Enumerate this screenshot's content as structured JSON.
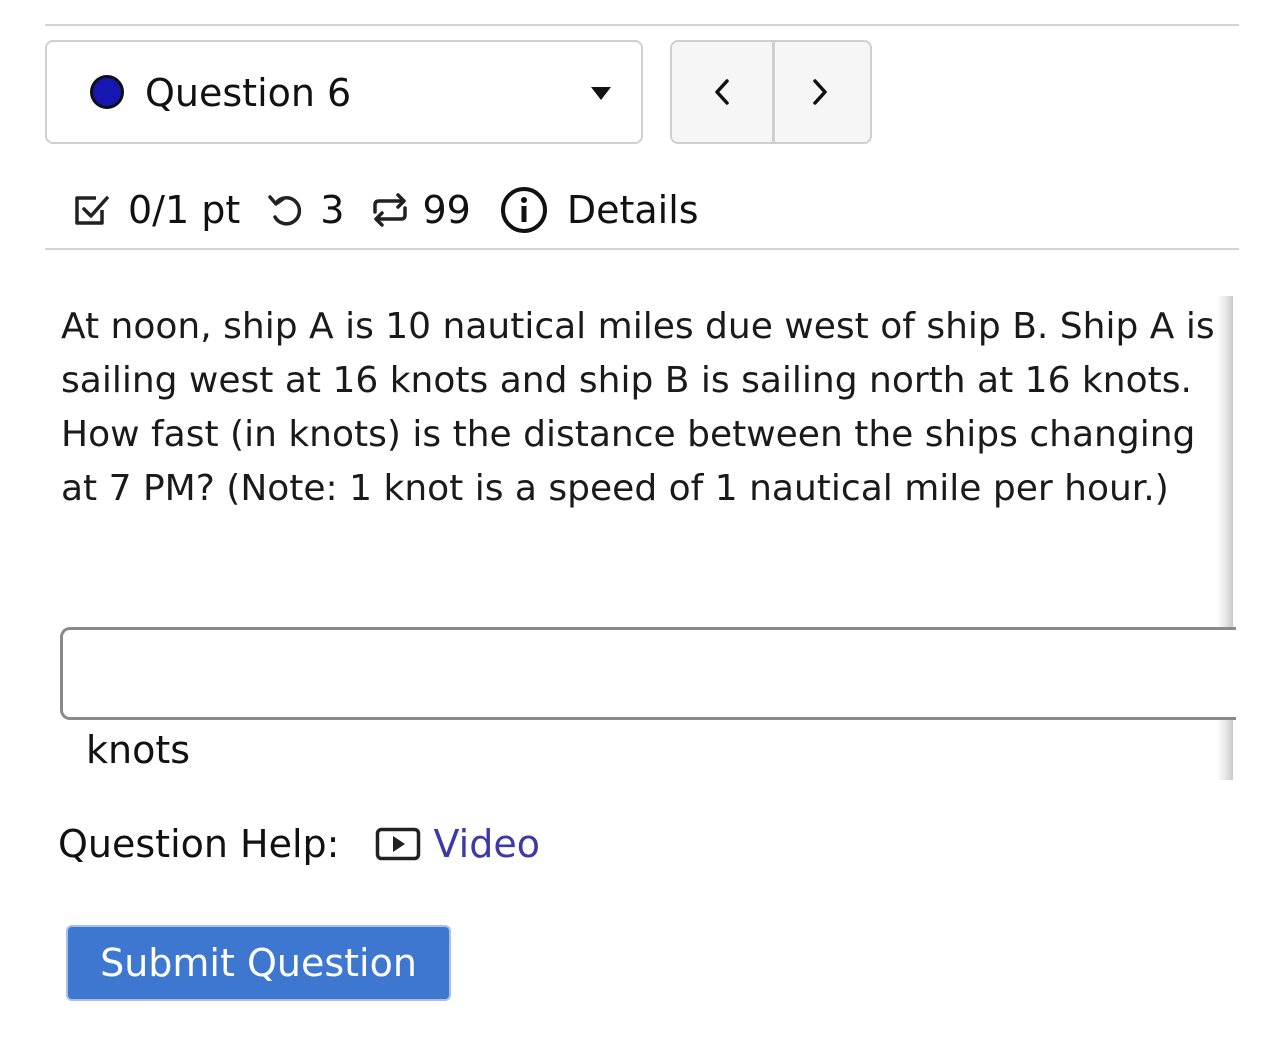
{
  "question_selector": {
    "label": "Question 6",
    "status_color": "#1616b0"
  },
  "nav": {
    "prev_icon": "chevron-left-icon",
    "next_icon": "chevron-right-icon"
  },
  "meta": {
    "points": "0/1 pt",
    "attempts": "3",
    "versions": "99",
    "details_label": "Details"
  },
  "question": {
    "text": "At noon, ship A is 10 nautical miles due west of ship B. Ship A is sailing west at 16 knots and ship B is sailing north at 16 knots. How fast (in knots) is the distance between the ships changing at 7 PM? (Note: 1 knot is a speed of 1 nautical mile per hour.)"
  },
  "answer": {
    "value": "",
    "units": "knots"
  },
  "help": {
    "label": "Question Help:",
    "video_label": "Video",
    "link_color": "#3a3aa8"
  },
  "submit": {
    "label": "Submit Question",
    "color": "#3d77d0"
  }
}
